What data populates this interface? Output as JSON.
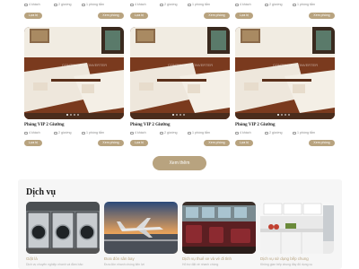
{
  "top_row": [
    {
      "guests": "4 khách",
      "beds": "2 giường",
      "rooms": "1 phòng tắm",
      "select_label": "Lựa bị",
      "view_label": "Xem phòng"
    },
    {
      "guests": "4 khách",
      "beds": "2 giường",
      "rooms": "1 phòng tắm",
      "select_label": "Lựa bị",
      "view_label": "Xem phòng"
    },
    {
      "guests": "4 khách",
      "beds": "2 giường",
      "rooms": "1 phòng tắm",
      "select_label": "Lựa bị",
      "view_label": "Xem phòng"
    }
  ],
  "rooms": [
    {
      "title": "Phòng VIP 2 Giường",
      "watermark": "CONTENTA · CONVERTER",
      "guests": "4 khách",
      "beds": "2 giường",
      "rooms": "1 phòng tắm",
      "select_label": "Lựa bị",
      "view_label": "Xem phòng"
    },
    {
      "title": "Phòng VIP 2 Giường",
      "watermark": "CONTENTA · CONVERTER",
      "guests": "4 khách",
      "beds": "2 giường",
      "rooms": "1 phòng tắm",
      "select_label": "Lựa bị",
      "view_label": "Xem phòng"
    },
    {
      "title": "Phòng VIP 2 Giường",
      "watermark": "CONTENTA · CONVERTER",
      "guests": "4 khách",
      "beds": "2 giường",
      "rooms": "1 phòng tắm",
      "select_label": "Lựa bị",
      "view_label": "Xem phòng"
    }
  ],
  "more_button": "Xem thêm",
  "services": {
    "title": "Dịch vụ",
    "items": [
      {
        "caption": "Giặt là",
        "desc": "Dịch vụ chuyên nghiệp nhanh và đảm bảo"
      },
      {
        "caption": "Đưa đón sân bay",
        "desc": "Đưa đón nhanh chóng tiện lợi"
      },
      {
        "caption": "Dịch vụ thuê xe và vé đi tỉnh",
        "desc": "Hỗ trợ đặt vé nhanh chóng"
      },
      {
        "caption": "Dịch vụ sử dụng bếp chung",
        "desc": "Không gian bếp chung đầy đủ dụng cụ"
      }
    ]
  },
  "colors": {
    "accent": "#b8a37f",
    "background": "#ffffff",
    "services_bg": "#f6f6f6"
  }
}
